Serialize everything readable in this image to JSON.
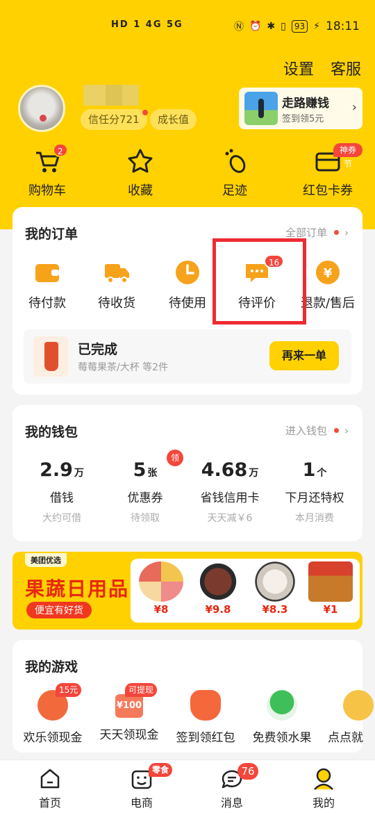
{
  "status_bar": {
    "network": "HD 1 4G  5G",
    "battery": "93",
    "time": "18:11"
  },
  "header": {
    "settings": "设置",
    "service": "客服"
  },
  "profile": {
    "trust_score": "信任分721",
    "growth": "成长值"
  },
  "walk_card": {
    "title": "走路赚钱",
    "subtitle": "签到领5元"
  },
  "quick_actions": [
    {
      "label": "购物车",
      "badge": "2"
    },
    {
      "label": "收藏"
    },
    {
      "label": "足迹"
    },
    {
      "label": "红包卡券",
      "badge": "神券节"
    }
  ],
  "orders": {
    "title": "我的订单",
    "all_link": "全部订单",
    "items": [
      {
        "label": "待付款"
      },
      {
        "label": "待收货"
      },
      {
        "label": "待使用"
      },
      {
        "label": "待评价",
        "badge": "16"
      },
      {
        "label": "退款/售后"
      }
    ],
    "completed": {
      "title": "已完成",
      "desc": "莓莓果茶/大杯 等2件",
      "button": "再来一单"
    }
  },
  "wallet": {
    "title": "我的钱包",
    "link": "进入钱包",
    "items": [
      {
        "value": "2.9",
        "unit": "万",
        "label": "借钱",
        "sub": "大约可借"
      },
      {
        "value": "5",
        "unit": "张",
        "label": "优惠券",
        "sub": "待领取",
        "badge": "领"
      },
      {
        "value": "4.68",
        "unit": "万",
        "label": "省钱信用卡",
        "sub": "天天减￥6"
      },
      {
        "value": "1",
        "unit": "个",
        "label": "下月还特权",
        "sub": "本月消费"
      }
    ]
  },
  "banner": {
    "tag": "美团优选",
    "headline": "果蔬日用品",
    "slogan": "便宜有好货",
    "prices": [
      "¥8",
      "¥9.8",
      "¥8.3",
      "¥1"
    ]
  },
  "games": {
    "title": "我的游戏",
    "items": [
      {
        "label": "欢乐领现金",
        "badge": "15元"
      },
      {
        "label": "天天领现金",
        "badge": "可提现",
        "icon_text": "¥100"
      },
      {
        "label": "签到领红包"
      },
      {
        "label": "免费领水果"
      },
      {
        "label": "点点就"
      }
    ]
  },
  "tabs": [
    {
      "label": "首页"
    },
    {
      "label": "电商",
      "badge": "零食"
    },
    {
      "label": "消息",
      "badge": "76"
    },
    {
      "label": "我的"
    }
  ],
  "colors": {
    "brand_yellow": "#ffd100",
    "badge_red": "#f4463b",
    "highlight_red": "#ee2b33"
  }
}
